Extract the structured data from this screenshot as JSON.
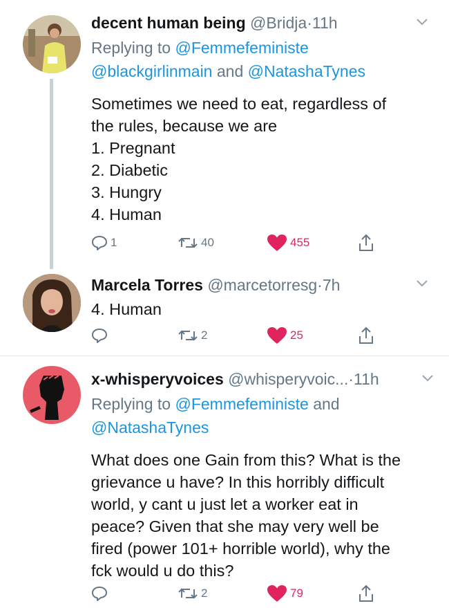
{
  "tweets": [
    {
      "name": "decent human being",
      "handle": "@Bridja",
      "dot": "·",
      "time": "11h",
      "replying_prefix": "Replying to",
      "replying_mentions_1": "@Femmefeministe",
      "replying_mentions_2": "@blackgirlinmain",
      "replying_and": "and",
      "replying_mentions_3": "@NatashaTynes",
      "text": "Sometimes we need to eat, regardless of\nthe rules, because we are\n1. Pregnant\n2. Diabetic\n3. Hungry\n4. Human",
      "replies": "1",
      "retweets": "40",
      "likes": "455",
      "avatar_colors": {
        "bg": "#a78b6a",
        "shirt": "#e8e36a"
      }
    },
    {
      "name": "Marcela Torres",
      "handle": "@marcetorresg",
      "dot": "·",
      "time": "7h",
      "text": "4. Human",
      "replies": "",
      "retweets": "2",
      "likes": "25",
      "avatar_colors": {
        "bg": "#8a6a55",
        "hair": "#3b2418"
      }
    },
    {
      "name": "x-whisperyvoices",
      "handle": "@whisperyvoic...",
      "dot": "·",
      "time": "11h",
      "replying_prefix": "Replying to",
      "replying_mentions_1": "@Femmefeministe",
      "replying_and": "and",
      "replying_mentions_2": "@NatashaTynes",
      "text": "What does one Gain from this? What is the\ngrievance u have? In this horribly difficult\nworld, y cant u just let a worker eat in\npeace? Given that she may very well be\nfired (power 101+ horrible world), why the\nfck would u do this?",
      "replies": "",
      "retweets": "2",
      "likes": "79",
      "avatar_colors": {
        "bg": "#e95a68",
        "fist": "#111111"
      }
    }
  ],
  "colors": {
    "link": "#1b95e0",
    "muted": "#657786",
    "like": "#e0245e",
    "thread": "#c9d1d8"
  },
  "icons": [
    "reply-icon",
    "retweet-icon",
    "heart-icon",
    "share-icon",
    "chevron-down-icon"
  ]
}
